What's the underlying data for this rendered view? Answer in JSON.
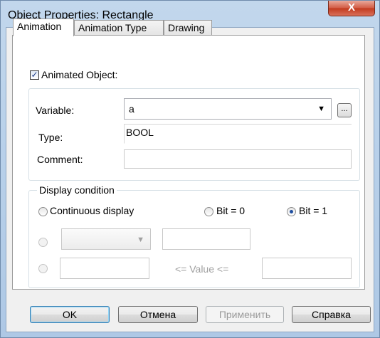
{
  "window": {
    "title": "Object Properties: Rectangle",
    "close_glyph": "X"
  },
  "tabs": [
    {
      "label": "Animation",
      "active": true
    },
    {
      "label": "Animation Type",
      "active": false
    },
    {
      "label": "Drawing",
      "active": false
    }
  ],
  "animated_object": {
    "label": "Animated Object:",
    "checked": true,
    "check_glyph": "✓"
  },
  "variable": {
    "label": "Variable:",
    "value": "a",
    "ellipsis": "..."
  },
  "type": {
    "label": "Type:",
    "value": "BOOL"
  },
  "comment": {
    "label": "Comment:",
    "value": ""
  },
  "display_condition": {
    "legend": "Display condition",
    "continuous": "Continuous display",
    "bit0": "Bit = 0",
    "bit1": "Bit = 1",
    "selected": "Bit = 1",
    "range_label": "<= Value <="
  },
  "buttons": {
    "ok": "OK",
    "cancel": "Отмена",
    "apply": "Применить",
    "help": "Справка"
  }
}
